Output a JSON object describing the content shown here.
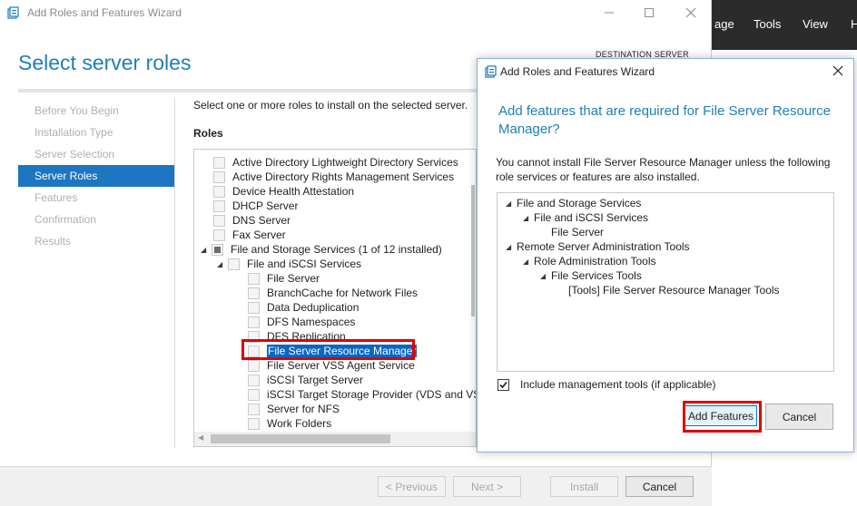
{
  "server_manager": {
    "menu": [
      "age",
      "Tools",
      "View",
      "H"
    ]
  },
  "wizard": {
    "title": "Add Roles and Features Wizard",
    "destination_label": "DESTINATION SERVER",
    "page_title": "Select server roles",
    "nav": [
      "Before You Begin",
      "Installation Type",
      "Server Selection",
      "Server Roles",
      "Features",
      "Confirmation",
      "Results"
    ],
    "instruction": "Select one or more roles to install on the selected server.",
    "roles_heading": "Roles",
    "roles": [
      "Active Directory Lightweight Directory Services",
      "Active Directory Rights Management Services",
      "Device Health Attestation",
      "DHCP Server",
      "DNS Server",
      "Fax Server",
      "File and Storage Services (1 of 12 installed)",
      "File and iSCSI Services",
      "File Server",
      "BranchCache for Network Files",
      "Data Deduplication",
      "DFS Namespaces",
      "DFS Replication",
      "File Server Resource Manager",
      "File Server VSS Agent Service",
      "iSCSI Target Server",
      "iSCSI Target Storage Provider (VDS and VSS",
      "Server for NFS",
      "Work Folders"
    ],
    "buttons": {
      "previous": "< Previous",
      "next": "Next >",
      "install": "Install",
      "cancel": "Cancel"
    }
  },
  "dialog": {
    "title": "Add Roles and Features Wizard",
    "heading": "Add features that are required for File Server Resource Manager?",
    "message": "You cannot install File Server Resource Manager unless the following role services or features are also installed.",
    "features": [
      "File and Storage Services",
      "File and iSCSI Services",
      "File Server",
      "Remote Server Administration Tools",
      "Role Administration Tools",
      "File Services Tools",
      "[Tools] File Server Resource Manager Tools"
    ],
    "include_tools_label": "Include management tools (if applicable)",
    "include_tools_checked": true,
    "buttons": {
      "add_features": "Add Features",
      "cancel": "Cancel"
    }
  },
  "colors": {
    "accent": "#1f7fb5",
    "nav_active": "#1c76c2",
    "highlight": "#e00000"
  }
}
